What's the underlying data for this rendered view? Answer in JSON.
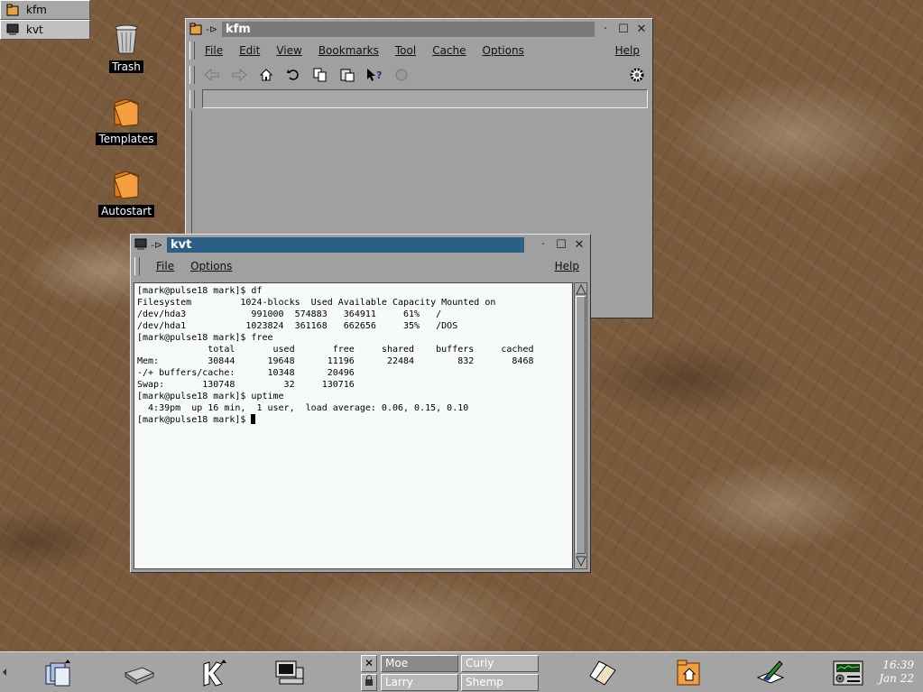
{
  "tasklist": [
    {
      "label": "kfm"
    },
    {
      "label": "kvt"
    }
  ],
  "desktop_icons": [
    {
      "label": "Trash"
    },
    {
      "label": "Templates"
    },
    {
      "label": "Autostart"
    }
  ],
  "kfm": {
    "title": "kfm",
    "menu": [
      "File",
      "Edit",
      "View",
      "Bookmarks",
      "Tool",
      "Cache",
      "Options"
    ],
    "help": "Help",
    "location": ""
  },
  "kvt": {
    "title": "kvt",
    "menu": [
      "File",
      "Options"
    ],
    "help": "Help",
    "terminal_lines": [
      "[mark@pulse18 mark]$ df",
      "Filesystem         1024-blocks  Used Available Capacity Mounted on",
      "/dev/hda3            991000  574883   364911     61%   /",
      "/dev/hda1           1023824  361168   662656     35%   /DOS",
      "[mark@pulse18 mark]$ free",
      "             total       used       free     shared    buffers     cached",
      "Mem:         30844      19648      11196      22484        832       8468",
      "-/+ buffers/cache:      10348      20496",
      "Swap:       130748         32     130716",
      "[mark@pulse18 mark]$ uptime",
      "  4:39pm  up 16 min,  1 user,  load average: 0.06, 0.15, 0.10",
      "[mark@pulse18 mark]$ "
    ]
  },
  "panel": {
    "desktops": [
      "Moe",
      "Curly",
      "Larry",
      "Shemp"
    ],
    "clock_time": "16:39",
    "clock_date": "Jan 22"
  },
  "colors": {
    "active_title": "#2c5f86",
    "inactive_title": "#7a7a7a",
    "panel": "#a4a4a4"
  }
}
